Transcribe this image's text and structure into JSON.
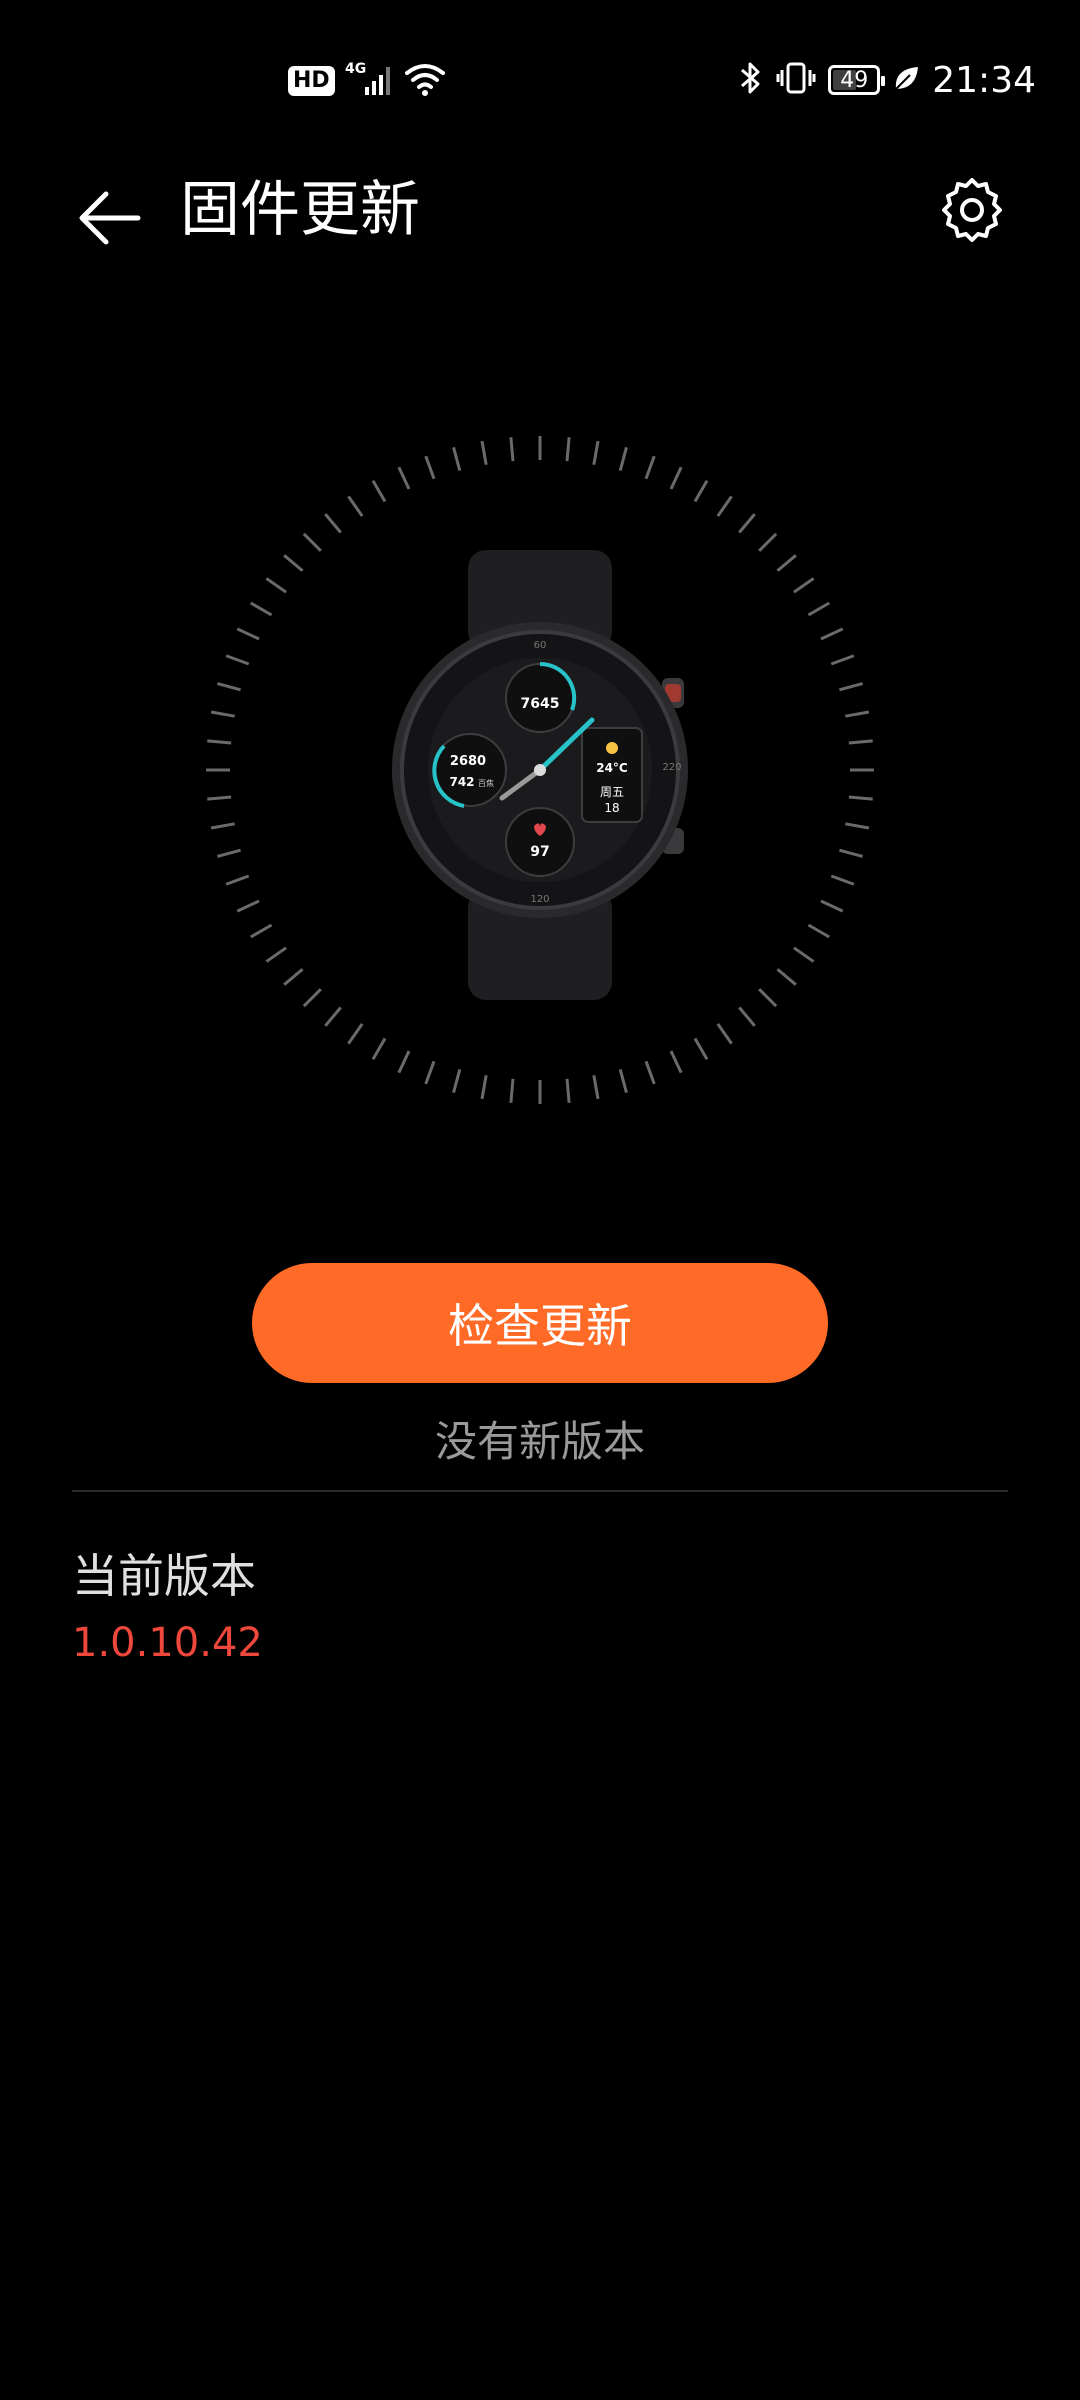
{
  "status_bar": {
    "hd": "HD",
    "network": "4G",
    "battery": "49",
    "time": "21:34"
  },
  "header": {
    "title": "固件更新"
  },
  "main": {
    "check_button": "检查更新",
    "status_text": "没有新版本",
    "current_version_label": "当前版本",
    "current_version_value": "1.0.10.42"
  },
  "watch_face": {
    "steps": "7645",
    "calories": "2680",
    "distance": "742",
    "distance_unit": "百焦",
    "temperature": "24°C",
    "weekday": "周五",
    "day": "18",
    "heart_rate": "97",
    "bezel_top": "60",
    "bezel_bottom": "120",
    "bezel_right": "220"
  },
  "colors": {
    "accent": "#ff6a26",
    "version": "#f0473c",
    "watch_highlight": "#27c3c8"
  },
  "icons": [
    "hd-icon",
    "signal-icon",
    "wifi-icon",
    "bluetooth-icon",
    "vibrate-icon",
    "battery-icon",
    "leaf-icon",
    "back-arrow-icon",
    "gear-icon"
  ]
}
